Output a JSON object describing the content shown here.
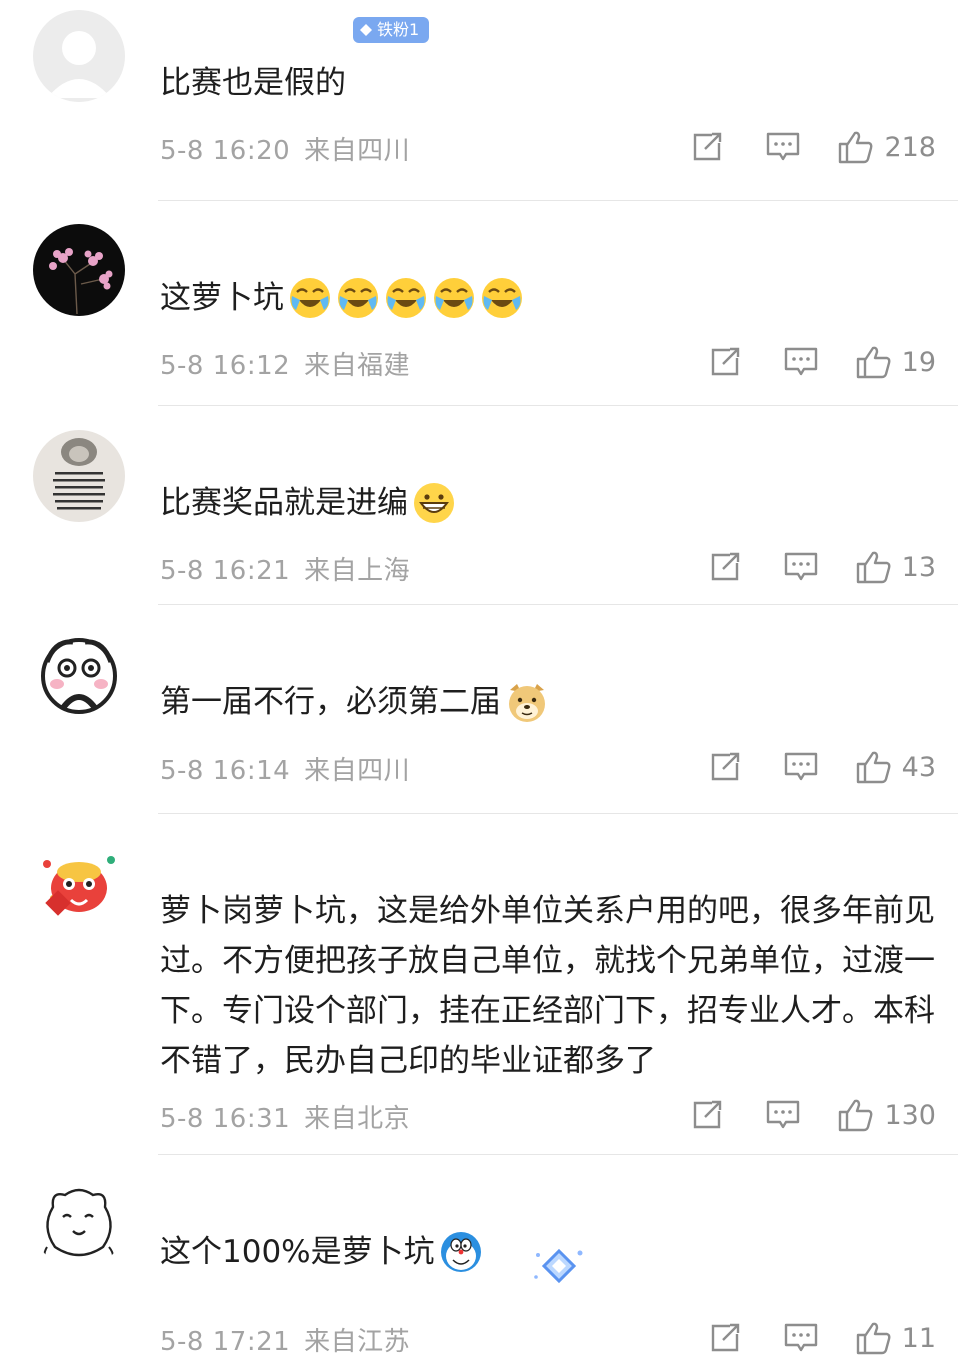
{
  "comments": [
    {
      "text": "比赛也是假的",
      "time": "5-8 16:20",
      "location": "来自四川",
      "likes": "218",
      "badge": "铁粉1",
      "avatar": "default-avatar"
    },
    {
      "text": "这萝卜坑",
      "time": "5-8 16:12",
      "location": "来自福建",
      "likes": "19",
      "emojis": [
        "laugh-cry-emoji",
        "laugh-cry-emoji",
        "laugh-cry-emoji",
        "laugh-cry-emoji",
        "laugh-cry-emoji"
      ],
      "avatar": "flower-avatar"
    },
    {
      "text": "比赛奖品就是进编",
      "time": "5-8 16:21",
      "location": "来自上海",
      "likes": "13",
      "emojis": [
        "grin-emoji"
      ],
      "avatar": "cat-text-avatar"
    },
    {
      "text": "第一届不行，必须第二届",
      "time": "5-8 16:14",
      "location": "来自四川",
      "likes": "43",
      "emojis": [
        "doge-emoji"
      ],
      "avatar": "panda-avatar"
    },
    {
      "text": "萝卜岗萝卜坑，这是给外单位关系户用的吧，很多年前见过。不方便把孩子放自己单位，就找个兄弟单位，过渡一下。专门设个部门，挂在正经部门下，招专业人才。本科不错了，民办自己印的毕业证都多了",
      "time": "5-8 16:31",
      "location": "来自北京",
      "likes": "130",
      "avatar": "lion-dance-avatar"
    },
    {
      "text": "这个100%是萝卜坑",
      "time": "5-8 17:21",
      "location": "来自江苏",
      "likes": "11",
      "emojis": [
        "doraemon-emoji"
      ],
      "avatar": "bear-doodle-avatar"
    }
  ],
  "colors": {
    "meta": "#a3a3a3",
    "icon": "#8d8d8d",
    "badge": "#7aa8f0",
    "divider": "#e6e6e6"
  }
}
